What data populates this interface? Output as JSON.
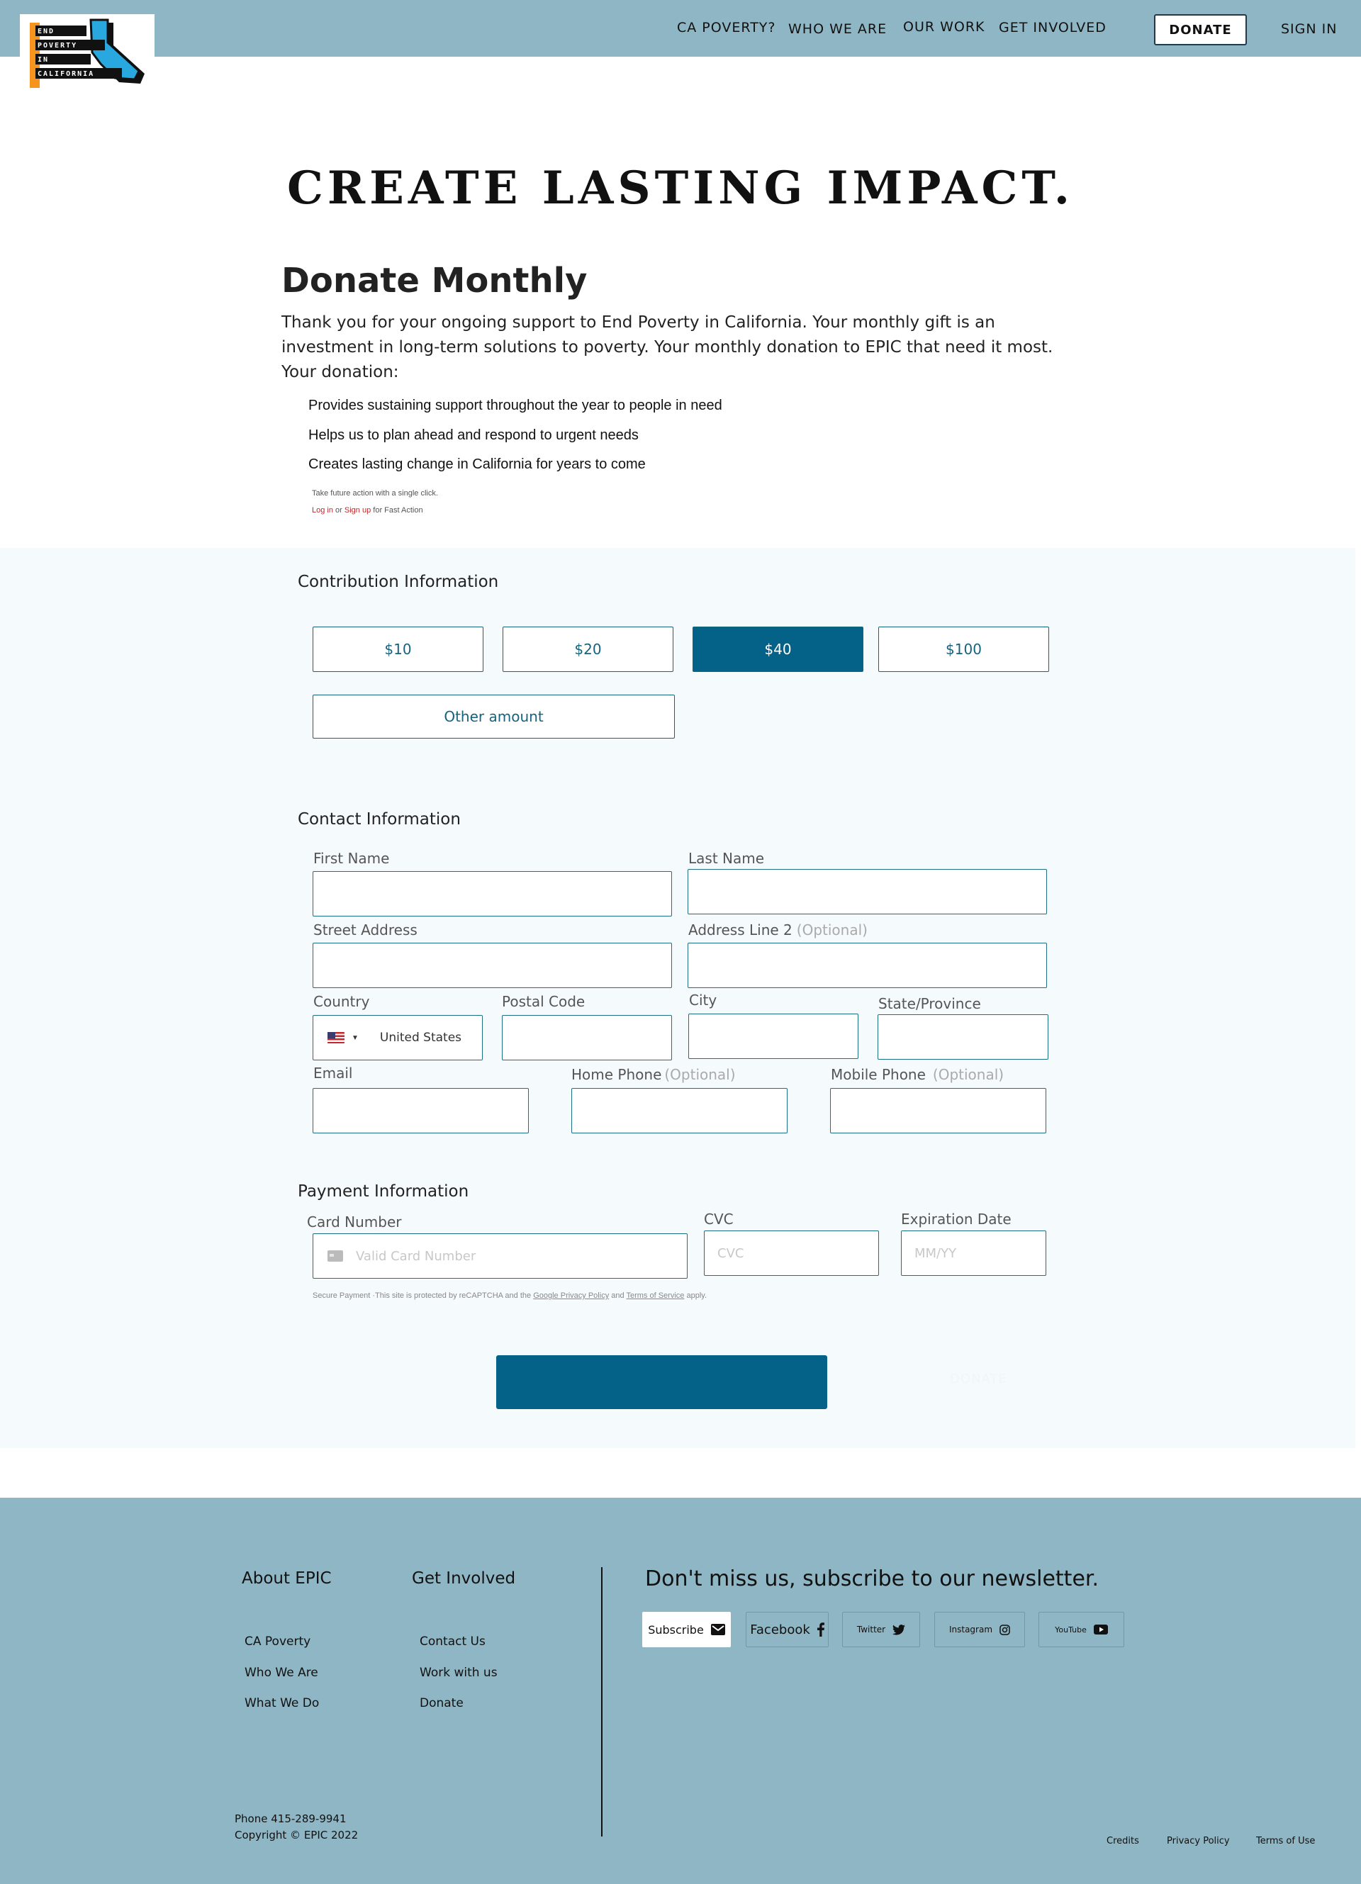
{
  "header": {
    "logo_lines": [
      "END",
      "POVERTY",
      "IN",
      "CALIFORNIA"
    ],
    "nav": [
      {
        "label": "CA POVERTY?"
      },
      {
        "label": "WHO WE ARE"
      },
      {
        "label": "OUR WORK"
      },
      {
        "label": "GET INVOLVED"
      }
    ],
    "donate_label": "DONATE",
    "signin_label": "SIGN IN"
  },
  "hero": {
    "title": "CREATE LASTING IMPACT.",
    "heading": "Donate Monthly",
    "intro": "Thank you for your ongoing support to End Poverty in California. Your monthly gift is an investment in long-term solutions to poverty. Your monthly donation to EPIC that need it most.",
    "your_donation": "Your donation:",
    "bullets": [
      "Provides sustaining support throughout the year to people in need",
      "Helps us to plan ahead and respond to urgent needs",
      "Creates lasting change in California for years to come"
    ],
    "fast_action_note": "Take future action with a single click.",
    "fast_action_login": "Log in",
    "fast_action_or": "or",
    "fast_action_signup": "Sign up",
    "fast_action_suffix": "for Fast Action"
  },
  "contribution": {
    "title": "Contribution Information",
    "amounts": [
      "$10",
      "$20",
      "$40",
      "$100"
    ],
    "selected_amount": "$40",
    "other_label": "Other amount"
  },
  "contact": {
    "title": "Contact Information",
    "first_name_label": "First Name",
    "last_name_label": "Last Name",
    "street_label": "Street Address",
    "address2_label": "Address Line 2",
    "optional": "(Optional)",
    "country_label": "Country",
    "country_value": "United States",
    "postal_label": "Postal Code",
    "city_label": "City",
    "state_label": "State/Province",
    "email_label": "Email",
    "home_phone_label": "Home Phone",
    "mobile_phone_label": "Mobile Phone"
  },
  "payment": {
    "title": "Payment Information",
    "card_label": "Card Number",
    "card_placeholder": "Valid Card Number",
    "cvc_label": "CVC",
    "cvc_placeholder": "CVC",
    "exp_label": "Expiration Date",
    "exp_placeholder": "MM/YY",
    "secure_prefix": "Secure Payment ·This site is protected by reCAPTCHA and the",
    "privacy_link": "Google Privacy Policy",
    "and": "and",
    "terms_link": "Terms of Service",
    "apply": "apply.",
    "submit_ghost_label": "DONATE"
  },
  "footer": {
    "about_heading": "About EPIC",
    "about_links": [
      "CA Poverty",
      "Who We Are",
      "What We Do"
    ],
    "involved_heading": "Get Involved",
    "involved_links": [
      "Contact Us",
      "Work with us",
      "Donate"
    ],
    "newsletter_heading": "Don't miss us, subscribe to our newsletter.",
    "social": {
      "subscribe": "Subscribe",
      "facebook": "Facebook",
      "twitter": "Twitter",
      "instagram": "Instagram",
      "youtube": "YouTube"
    },
    "phone": "Phone 415-289-9941",
    "copyright": "Copyright © EPIC 2022",
    "legal": [
      "Credits",
      "Privacy Policy",
      "Terms of Use"
    ]
  },
  "colors": {
    "header_bg": "#8fb6c4",
    "accent": "#046188",
    "form_bg": "#f5fafc",
    "logo_orange": "#f7941d",
    "logo_blue": "#29a8e0"
  }
}
